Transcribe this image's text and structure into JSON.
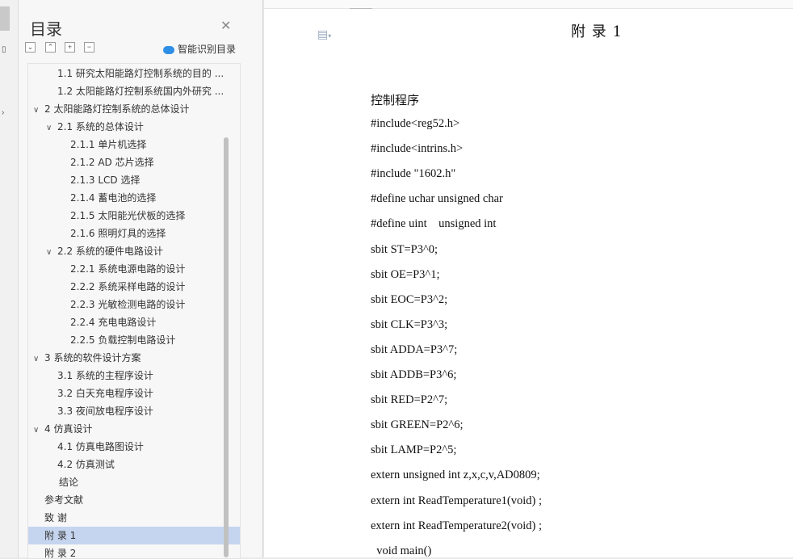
{
  "toc": {
    "title": "目录",
    "close": "✕",
    "controls": [
      "⌄",
      "⌃",
      "+",
      "−"
    ],
    "smart_label": "智能识别目录",
    "items": [
      {
        "text": "1.1 研究太阳能路灯控制系统的目的 ...",
        "level": 2,
        "chev": ""
      },
      {
        "text": "1.2 太阳能路灯控制系统国内外研究 ...",
        "level": 2,
        "chev": ""
      },
      {
        "text": "2 太阳能路灯控制系统的总体设计",
        "level": 1,
        "chev": "∨"
      },
      {
        "text": "2.1  系统的总体设计",
        "level": 2,
        "chev": "∨"
      },
      {
        "text": "2.1.1  单片机选择",
        "level": 3,
        "chev": ""
      },
      {
        "text": "2.1.2 AD 芯片选择",
        "level": 3,
        "chev": ""
      },
      {
        "text": "2.1.3 LCD 选择",
        "level": 3,
        "chev": ""
      },
      {
        "text": "2.1.4  蓄电池的选择",
        "level": 3,
        "chev": ""
      },
      {
        "text": "2.1.5 太阳能光伏板的选择",
        "level": 3,
        "chev": ""
      },
      {
        "text": "2.1.6 照明灯具的选择",
        "level": 3,
        "chev": ""
      },
      {
        "text": "2.2 系统的硬件电路设计",
        "level": 2,
        "chev": "∨"
      },
      {
        "text": "2.2.1 系统电源电路的设计",
        "level": 3,
        "chev": ""
      },
      {
        "text": "2.2.2 系统采样电路的设计",
        "level": 3,
        "chev": ""
      },
      {
        "text": "2.2.3 光敏检测电路的设计",
        "level": 3,
        "chev": ""
      },
      {
        "text": "2.2.4 充电电路设计",
        "level": 3,
        "chev": ""
      },
      {
        "text": "2.2.5 负载控制电路设计",
        "level": 3,
        "chev": ""
      },
      {
        "text": "3 系统的软件设计方案",
        "level": 1,
        "chev": "∨"
      },
      {
        "text": "3.1  系统的主程序设计",
        "level": 2,
        "chev": ""
      },
      {
        "text": "3.2 白天充电程序设计",
        "level": 2,
        "chev": ""
      },
      {
        "text": "3.3 夜间放电程序设计",
        "level": 2,
        "chev": ""
      },
      {
        "text": "4 仿真设计",
        "level": 1,
        "chev": "∨"
      },
      {
        "text": "4.1 仿真电路图设计",
        "level": 2,
        "chev": ""
      },
      {
        "text": "4.2  仿真测试",
        "level": 2,
        "chev": ""
      },
      {
        "text": "结论",
        "level": 0,
        "chev": ""
      },
      {
        "text": "参考文献",
        "level": 1,
        "chev": ""
      },
      {
        "text": "致    谢",
        "level": 1,
        "chev": ""
      },
      {
        "text": "附    录 1",
        "level": 1,
        "chev": "",
        "selected": true
      },
      {
        "text": "附    录 2",
        "level": 1,
        "chev": ""
      }
    ]
  },
  "document": {
    "title": "附    录 1",
    "heading": "控制程序",
    "lines": [
      "#include<reg52.h>",
      "#include<intrins.h>",
      "#include \"1602.h\"",
      "#define uchar unsigned char",
      "#define uint    unsigned int",
      "sbit ST=P3^0;",
      "sbit OE=P3^1;",
      "sbit EOC=P3^2;",
      "sbit CLK=P3^3;",
      "sbit ADDA=P3^7;",
      "sbit ADDB=P3^6;",
      "sbit RED=P2^7;",
      "sbit GREEN=P2^6;",
      "sbit LAMP=P2^5;",
      "extern unsigned int z,x,c,v,AD0809;",
      "extern int ReadTemperature1(void) ;",
      "extern int ReadTemperature2(void) ;",
      "  void main()"
    ]
  }
}
